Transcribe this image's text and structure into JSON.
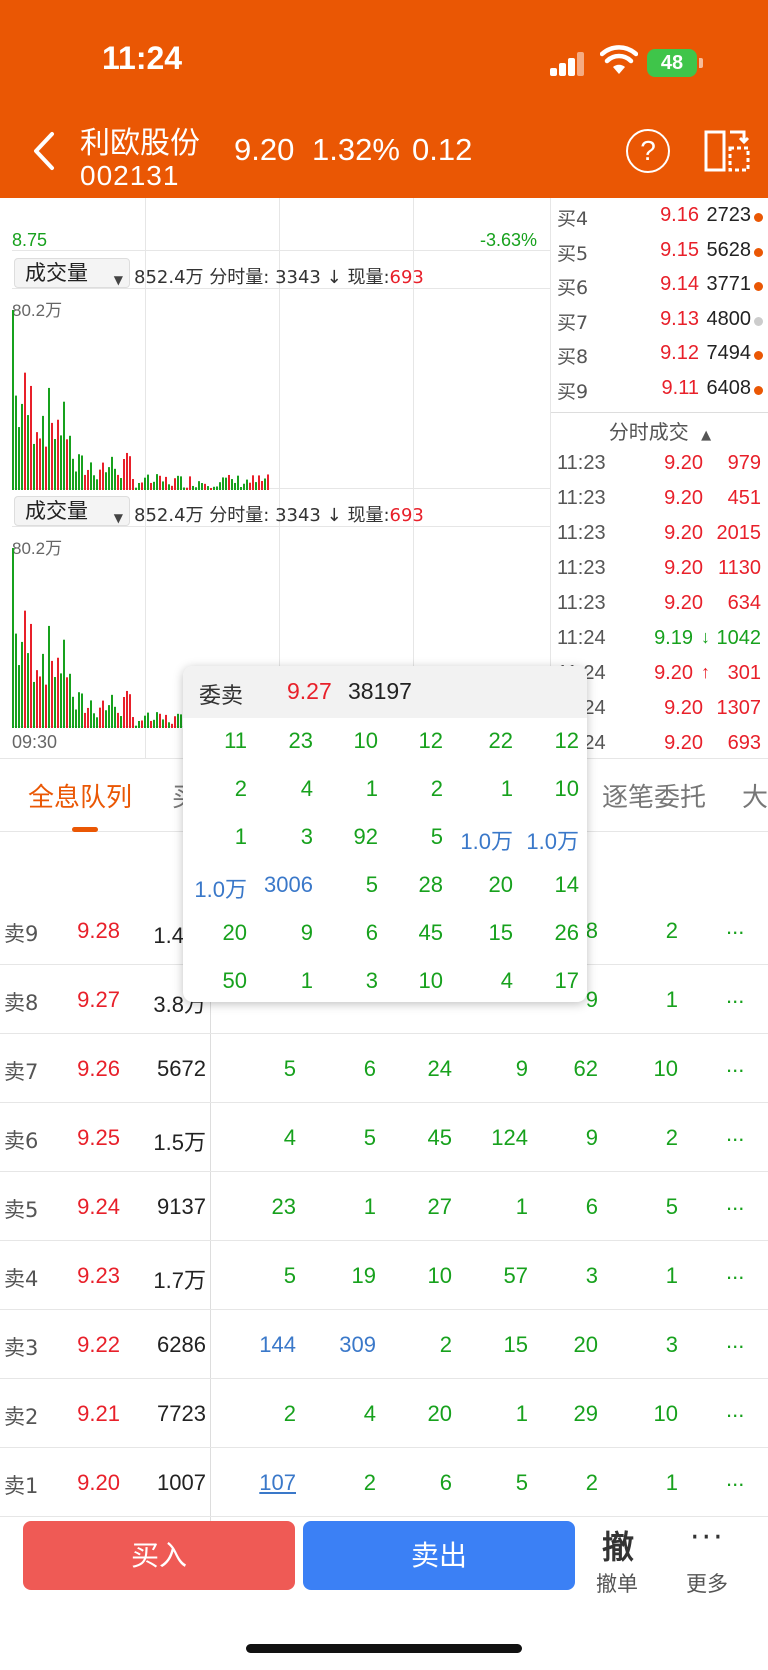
{
  "status_bar": {
    "time": "11:24",
    "battery": "48"
  },
  "header": {
    "stock_name": "利欧股份",
    "stock_code": "002131",
    "price": "9.20",
    "change_pct": "1.32%",
    "change": "0.12"
  },
  "chart": {
    "price_low": "8.75",
    "pct_low": "-3.63%",
    "volume_panels": [
      {
        "select_label": "成交量",
        "total": "852.4万",
        "min_label": "分时量:",
        "min_value": "3343",
        "arrow": "↓",
        "now_label": "现量:",
        "now_value": "693",
        "max_label": "80.2万"
      },
      {
        "select_label": "成交量",
        "total": "852.4万",
        "min_label": "分时量:",
        "min_value": "3343",
        "arrow": "↓",
        "now_label": "现量:",
        "now_value": "693",
        "max_label": "80.2万"
      }
    ],
    "time_start": "09:30"
  },
  "order_book": {
    "buy_levels": [
      {
        "label": "买4",
        "price": "9.16",
        "volume": "2723",
        "dot": "orange"
      },
      {
        "label": "买5",
        "price": "9.15",
        "volume": "5628",
        "dot": "orange"
      },
      {
        "label": "买6",
        "price": "9.14",
        "volume": "3771",
        "dot": "orange"
      },
      {
        "label": "买7",
        "price": "9.13",
        "volume": "4800",
        "dot": "gray"
      },
      {
        "label": "买8",
        "price": "9.12",
        "volume": "7494",
        "dot": "orange"
      },
      {
        "label": "买9",
        "price": "9.11",
        "volume": "6408",
        "dot": "orange"
      }
    ],
    "trades_title": "分时成交",
    "trades": [
      {
        "time": "11:23",
        "price": "9.20",
        "arrow": "",
        "volume": "979",
        "color": "red"
      },
      {
        "time": "11:23",
        "price": "9.20",
        "arrow": "",
        "volume": "451",
        "color": "red"
      },
      {
        "time": "11:23",
        "price": "9.20",
        "arrow": "",
        "volume": "2015",
        "color": "red"
      },
      {
        "time": "11:23",
        "price": "9.20",
        "arrow": "",
        "volume": "1130",
        "color": "red"
      },
      {
        "time": "11:23",
        "price": "9.20",
        "arrow": "",
        "volume": "634",
        "color": "red"
      },
      {
        "time": "11:24",
        "price": "9.19",
        "arrow": "↓",
        "volume": "1042",
        "color": "green"
      },
      {
        "time": "11:24",
        "price": "9.20",
        "arrow": "↑",
        "volume": "301",
        "color": "red"
      },
      {
        "time": "11:24",
        "price": "9.20",
        "arrow": "",
        "volume": "1307",
        "color": "red"
      },
      {
        "time": "11:24",
        "price": "9.20",
        "arrow": "",
        "volume": "693",
        "color": "red"
      }
    ]
  },
  "tabs": [
    {
      "label": "全息队列",
      "active": true
    },
    {
      "label": "买",
      "active": false
    },
    {
      "label": "逐笔委托",
      "active": false
    },
    {
      "label": "大",
      "active": false
    }
  ],
  "queue": [
    {
      "label": "卖9",
      "price": "9.28",
      "total": "1.4万",
      "cells": [
        [
          "",
          ""
        ],
        [
          "",
          ""
        ],
        [
          "",
          ""
        ],
        [
          "",
          ""
        ],
        [
          "8",
          "green"
        ],
        [
          "2",
          "green"
        ]
      ]
    },
    {
      "label": "卖8",
      "price": "9.27",
      "total": "3.8万",
      "cells": [
        [
          "",
          ""
        ],
        [
          "",
          ""
        ],
        [
          "",
          ""
        ],
        [
          "",
          ""
        ],
        [
          "9",
          "green"
        ],
        [
          "1",
          "green"
        ]
      ]
    },
    {
      "label": "卖7",
      "price": "9.26",
      "total": "5672",
      "cells": [
        [
          "5",
          "green"
        ],
        [
          "6",
          "green"
        ],
        [
          "24",
          "green"
        ],
        [
          "9",
          "green"
        ],
        [
          "62",
          "green"
        ],
        [
          "10",
          "green"
        ]
      ]
    },
    {
      "label": "卖6",
      "price": "9.25",
      "total": "1.5万",
      "cells": [
        [
          "4",
          "green"
        ],
        [
          "5",
          "green"
        ],
        [
          "45",
          "green"
        ],
        [
          "124",
          "green"
        ],
        [
          "9",
          "green"
        ],
        [
          "2",
          "green"
        ]
      ]
    },
    {
      "label": "卖5",
      "price": "9.24",
      "total": "9137",
      "cells": [
        [
          "23",
          "green"
        ],
        [
          "1",
          "green"
        ],
        [
          "27",
          "green"
        ],
        [
          "1",
          "green"
        ],
        [
          "6",
          "green"
        ],
        [
          "5",
          "green"
        ]
      ]
    },
    {
      "label": "卖4",
      "price": "9.23",
      "total": "1.7万",
      "cells": [
        [
          "5",
          "green"
        ],
        [
          "19",
          "green"
        ],
        [
          "10",
          "green"
        ],
        [
          "57",
          "green"
        ],
        [
          "3",
          "green"
        ],
        [
          "1",
          "green"
        ]
      ]
    },
    {
      "label": "卖3",
      "price": "9.22",
      "total": "6286",
      "cells": [
        [
          "144",
          "blue"
        ],
        [
          "309",
          "blue"
        ],
        [
          "2",
          "green"
        ],
        [
          "15",
          "green"
        ],
        [
          "20",
          "green"
        ],
        [
          "3",
          "green"
        ]
      ]
    },
    {
      "label": "卖2",
      "price": "9.21",
      "total": "7723",
      "cells": [
        [
          "2",
          "green"
        ],
        [
          "4",
          "green"
        ],
        [
          "20",
          "green"
        ],
        [
          "1",
          "green"
        ],
        [
          "29",
          "green"
        ],
        [
          "10",
          "green"
        ]
      ]
    },
    {
      "label": "卖1",
      "price": "9.20",
      "total": "1007",
      "cells": [
        [
          "107",
          "link"
        ],
        [
          "2",
          "green"
        ],
        [
          "6",
          "green"
        ],
        [
          "5",
          "green"
        ],
        [
          "2",
          "green"
        ],
        [
          "1",
          "green"
        ]
      ]
    }
  ],
  "more_symbol": "...",
  "popup": {
    "label": "委卖",
    "price": "9.27",
    "volume": "38197",
    "rows": [
      [
        [
          "11",
          "green"
        ],
        [
          "23",
          "green"
        ],
        [
          "10",
          "green"
        ],
        [
          "12",
          "green"
        ],
        [
          "22",
          "green"
        ],
        [
          "12",
          "green"
        ]
      ],
      [
        [
          "2",
          "green"
        ],
        [
          "4",
          "green"
        ],
        [
          "1",
          "green"
        ],
        [
          "2",
          "green"
        ],
        [
          "1",
          "green"
        ],
        [
          "10",
          "green"
        ]
      ],
      [
        [
          "1",
          "green"
        ],
        [
          "3",
          "green"
        ],
        [
          "92",
          "green"
        ],
        [
          "5",
          "green"
        ],
        [
          "1.0万",
          "blue"
        ],
        [
          "1.0万",
          "blue"
        ]
      ],
      [
        [
          "1.0万",
          "blue"
        ],
        [
          "3006",
          "blue"
        ],
        [
          "5",
          "green"
        ],
        [
          "28",
          "green"
        ],
        [
          "20",
          "green"
        ],
        [
          "14",
          "green"
        ]
      ],
      [
        [
          "20",
          "green"
        ],
        [
          "9",
          "green"
        ],
        [
          "6",
          "green"
        ],
        [
          "45",
          "green"
        ],
        [
          "15",
          "green"
        ],
        [
          "26",
          "green"
        ]
      ],
      [
        [
          "50",
          "green"
        ],
        [
          "1",
          "green"
        ],
        [
          "3",
          "green"
        ],
        [
          "10",
          "green"
        ],
        [
          "4",
          "green"
        ],
        [
          "17",
          "green"
        ]
      ]
    ]
  },
  "bottom_bar": {
    "buy_label": "买入",
    "sell_label": "卖出",
    "cancel_icon": "撤",
    "cancel_label": "撤单",
    "more_icon": "···",
    "more_label": "更多"
  },
  "colors": {
    "brand": "#ea5704",
    "up": "#e8202a",
    "down": "#17a11d",
    "buy_button": "#ef5a55",
    "sell_button": "#3b80f5"
  }
}
